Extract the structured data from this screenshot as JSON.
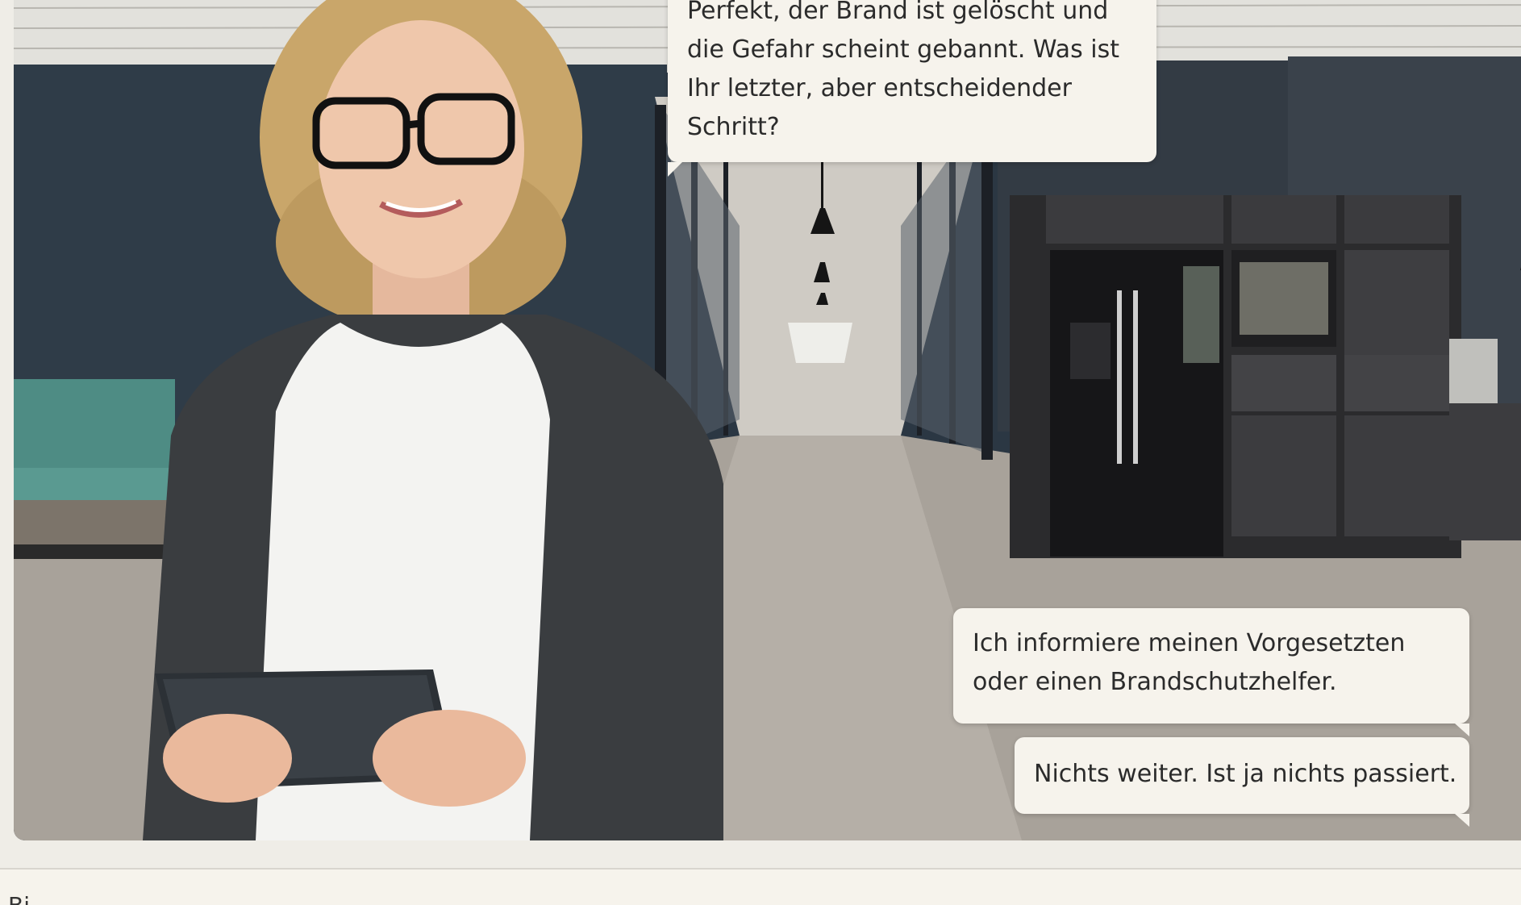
{
  "scenario": {
    "npc_message_lines": [
      "Perfekt, der Brand ist gelöscht und",
      "die Gefahr scheint gebannt. Was ist",
      "Ihr letzter, aber entscheidender",
      "Schritt?"
    ],
    "answer_options": [
      {
        "lines": [
          "Ich informiere meinen Vorgesetzten",
          "oder einen Brandschutzhelfer."
        ]
      },
      {
        "lines": [
          "Nichts weiter. Ist ja nichts passiert."
        ]
      }
    ]
  },
  "bottom_panel": {
    "label": "Bi"
  }
}
